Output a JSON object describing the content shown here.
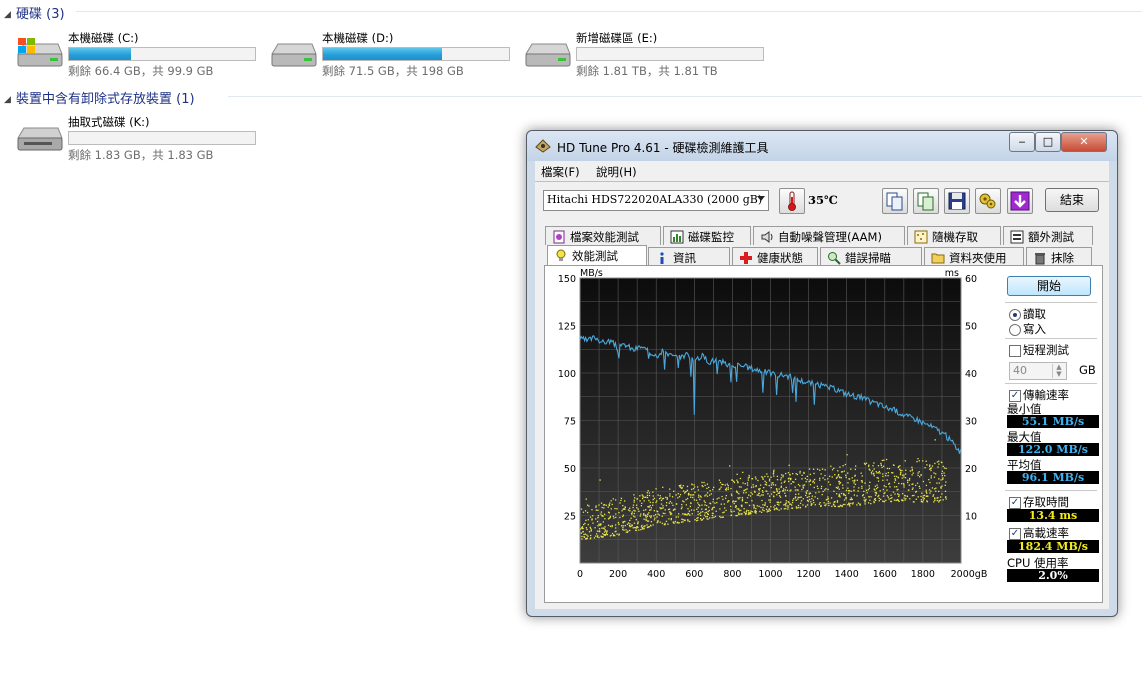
{
  "explorer": {
    "hdd_group": "硬碟 (3)",
    "removable_group": "裝置中含有卸除式存放裝置 (1)",
    "drives": [
      {
        "name": "本機磁碟 (C:)",
        "info": "剩餘 66.4 GB，共 99.9 GB",
        "used_fraction": 0.335
      },
      {
        "name": "本機磁碟 (D:)",
        "info": "剩餘 71.5 GB，共 198 GB",
        "used_fraction": 0.64
      },
      {
        "name": "新增磁碟區 (E:)",
        "info": "剩餘 1.81 TB，共 1.81 TB",
        "used_fraction": 0.0
      }
    ],
    "removable": [
      {
        "name": "抽取式磁碟 (K:)",
        "info": "剩餘 1.83 GB，共 1.83 GB",
        "used_fraction": 0.0
      }
    ]
  },
  "window": {
    "title": "HD Tune Pro 4.61 - 硬碟檢測維護工具",
    "controls": {
      "minimize": "‒",
      "maximize": "□",
      "close": "✕"
    },
    "menu": [
      "檔案(F)",
      "說明(H)"
    ],
    "drive_select": "Hitachi HDS722020ALA330 (2000 gB)",
    "temperature": "35℃",
    "exit_label": "結束",
    "tabs_row1": [
      "檔案效能測試",
      "磁碟監控",
      "自動噪聲管理(AAM)",
      "隨機存取",
      "額外測試"
    ],
    "tabs_row2": [
      "效能測試",
      "資訊",
      "健康狀態",
      "錯誤掃瞄",
      "資料夾使用",
      "抹除"
    ],
    "start_label": "開始",
    "read_label": "讀取",
    "write_label": "寫入",
    "short_test_label": "短程測試",
    "short_test_value": "40",
    "short_test_unit": "GB",
    "transfer_rate_label": "傳輸速率",
    "min_label": "最小值",
    "min_value": "55.1 MB/s",
    "max_label": "最大值",
    "max_value": "122.0 MB/s",
    "avg_label": "平均值",
    "avg_value": "96.1 MB/s",
    "access_time_label": "存取時間",
    "access_time_value": "13.4 ms",
    "burst_label": "高載速率",
    "burst_value": "182.4 MB/s",
    "cpu_label": "CPU 使用率",
    "cpu_value": "2.0%",
    "colors": {
      "transfer": "#4aa8dc",
      "access": "#e9e54a",
      "value_blue": "#3db4f2",
      "value_yellow": "#f4ec1c",
      "value_white": "#ffffff"
    }
  },
  "chart_data": {
    "type": "line",
    "xlabel": "gB",
    "ylabel_left": "MB/s",
    "ylabel_right": "ms",
    "xlim": [
      0,
      2000
    ],
    "ylim_left": [
      0,
      150
    ],
    "ylim_right": [
      0,
      60
    ],
    "x_ticks": [
      "0",
      "200",
      "400",
      "600",
      "800",
      "1000",
      "1200",
      "1400",
      "1600",
      "1800",
      "2000gB"
    ],
    "y_ticks_left": [
      "150",
      "125",
      "100",
      "75",
      "50",
      "25"
    ],
    "y_ticks_right": [
      "60",
      "50",
      "40",
      "30",
      "20",
      "10"
    ],
    "grid": true,
    "series": [
      {
        "values_x": [
          0,
          40,
          80,
          120,
          160,
          200,
          240,
          280,
          320,
          360,
          400,
          440,
          480,
          520,
          560,
          600,
          640,
          680,
          720,
          760,
          800,
          840,
          880,
          920,
          960,
          1000,
          1040,
          1080,
          1120,
          1160,
          1200,
          1240,
          1280,
          1320,
          1360,
          1400,
          1440,
          1480,
          1520,
          1560,
          1600,
          1640,
          1680,
          1720,
          1760,
          1800,
          1840,
          1880,
          1920,
          1960,
          2000
        ],
        "values_y": [
          118,
          117,
          119,
          116,
          117,
          113,
          115,
          112,
          114,
          111,
          110,
          112,
          109,
          108,
          110,
          107,
          109,
          106,
          107,
          105,
          104,
          104,
          103,
          102,
          101,
          100,
          99,
          99,
          97,
          96,
          95,
          94,
          93,
          92,
          91,
          89,
          88,
          87,
          85,
          84,
          82,
          81,
          79,
          77,
          76,
          74,
          72,
          70,
          67,
          63,
          58
        ]
      },
      {
        "type": "scatter",
        "band": [
          [
            0,
            5,
            12
          ],
          [
            200,
            6,
            14
          ],
          [
            400,
            8,
            16
          ],
          [
            600,
            9,
            17
          ],
          [
            800,
            10,
            18
          ],
          [
            1000,
            11,
            19
          ],
          [
            1200,
            12,
            20
          ],
          [
            1400,
            12,
            21
          ],
          [
            1600,
            13,
            22
          ],
          [
            1800,
            13,
            22
          ],
          [
            1900,
            13,
            22
          ]
        ],
        "count": 1400
      }
    ]
  }
}
